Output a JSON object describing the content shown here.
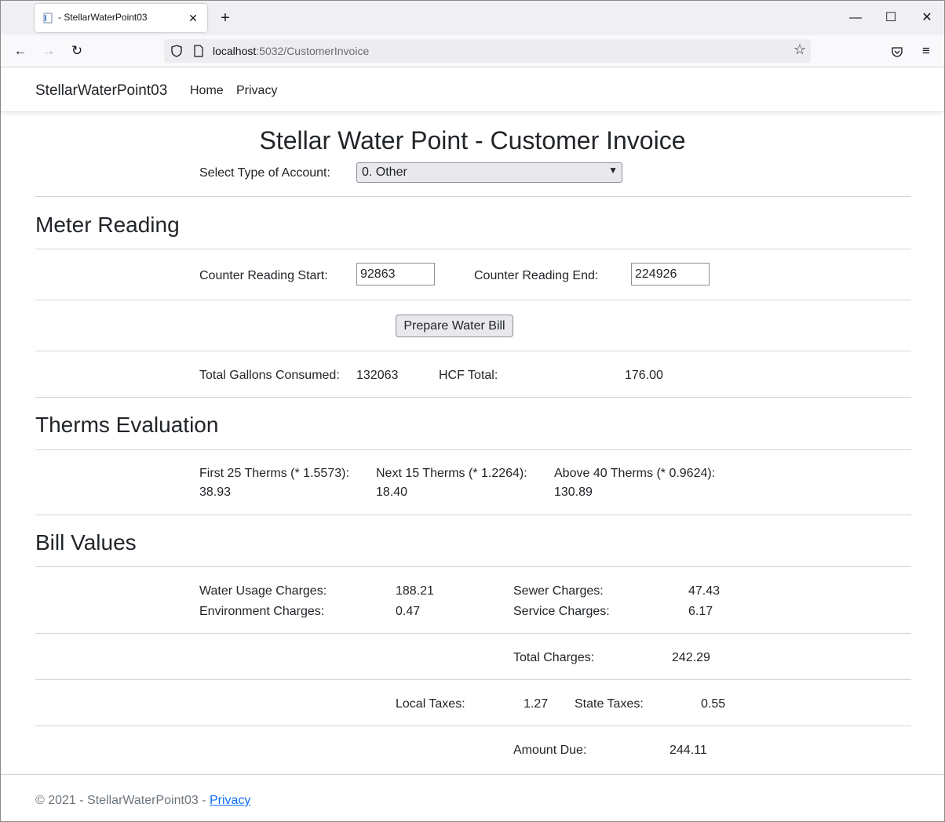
{
  "browser": {
    "tab_title": "- StellarWaterPoint03",
    "url_host": "localhost",
    "url_rest": ":5032/CustomerInvoice"
  },
  "site": {
    "brand": "StellarWaterPoint03",
    "nav": [
      "Home",
      "Privacy"
    ]
  },
  "page": {
    "title": "Stellar Water Point - Customer Invoice",
    "account_label": "Select Type of Account:",
    "account_value": "0. Other"
  },
  "meter": {
    "heading": "Meter Reading",
    "start_label": "Counter Reading Start:",
    "start_value": "92863",
    "end_label": "Counter Reading End:",
    "end_value": "224926",
    "button": "Prepare Water Bill",
    "gallons_label": "Total Gallons Consumed:",
    "gallons_value": "132063",
    "hcf_label": "HCF Total:",
    "hcf_value": "176.00"
  },
  "therms": {
    "heading": "Therms Evaluation",
    "first_label": "First 25 Therms (* 1.5573):",
    "first_value": "38.93",
    "next_label": "Next 15 Therms (* 1.2264):",
    "next_value": "18.40",
    "above_label": "Above 40 Therms (* 0.9624):",
    "above_value": "130.89"
  },
  "bill": {
    "heading": "Bill Values",
    "water_label": "Water Usage Charges:",
    "water_value": "188.21",
    "sewer_label": "Sewer Charges:",
    "sewer_value": "47.43",
    "env_label": "Environment Charges:",
    "env_value": "0.47",
    "service_label": "Service Charges:",
    "service_value": "6.17",
    "total_label": "Total Charges:",
    "total_value": "242.29",
    "local_label": "Local Taxes:",
    "local_value": "1.27",
    "state_label": "State Taxes:",
    "state_value": "0.55",
    "due_label": "Amount Due:",
    "due_value": "244.11"
  },
  "footer": {
    "text": "© 2021 - StellarWaterPoint03 - ",
    "link": "Privacy"
  }
}
